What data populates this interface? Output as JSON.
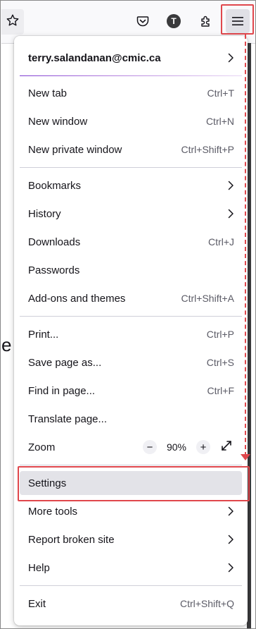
{
  "toolbar": {
    "bookmark_star_icon": "star-icon",
    "pocket_icon": "pocket-icon",
    "account_avatar_letter": "T",
    "extensions_icon": "puzzle-icon",
    "menu_icon": "hamburger-menu-icon"
  },
  "page": {
    "peek_text": "e"
  },
  "menu": {
    "account": {
      "label": "terry.salandanan@cmic.ca"
    },
    "items": [
      {
        "label": "New tab",
        "shortcut": "Ctrl+T"
      },
      {
        "label": "New window",
        "shortcut": "Ctrl+N"
      },
      {
        "label": "New private window",
        "shortcut": "Ctrl+Shift+P"
      },
      {
        "label": "Bookmarks",
        "shortcut": ""
      },
      {
        "label": "History",
        "shortcut": ""
      },
      {
        "label": "Downloads",
        "shortcut": "Ctrl+J"
      },
      {
        "label": "Passwords",
        "shortcut": ""
      },
      {
        "label": "Add-ons and themes",
        "shortcut": "Ctrl+Shift+A"
      },
      {
        "label": "Print...",
        "shortcut": "Ctrl+P"
      },
      {
        "label": "Save page as...",
        "shortcut": "Ctrl+S"
      },
      {
        "label": "Find in page...",
        "shortcut": "Ctrl+F"
      },
      {
        "label": "Translate page...",
        "shortcut": ""
      },
      {
        "label": "Zoom",
        "shortcut": ""
      },
      {
        "label": "Settings",
        "shortcut": ""
      },
      {
        "label": "More tools",
        "shortcut": ""
      },
      {
        "label": "Report broken site",
        "shortcut": ""
      },
      {
        "label": "Help",
        "shortcut": ""
      },
      {
        "label": "Exit",
        "shortcut": "Ctrl+Shift+Q"
      }
    ],
    "zoom": {
      "minus": "−",
      "value": "90%",
      "plus": "+"
    }
  },
  "colors": {
    "highlight": "#e0474c",
    "selected_row": "#e3e3e8",
    "accent_gradient_start": "#7d3bd1"
  }
}
